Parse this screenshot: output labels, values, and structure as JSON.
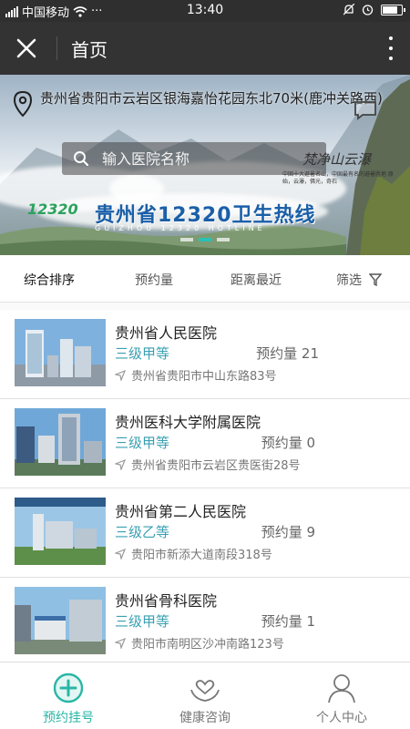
{
  "status_bar": {
    "carrier": "中国移动",
    "more": "···",
    "time": "13:40",
    "battery_level": 0.85
  },
  "header": {
    "title": "首页"
  },
  "banner": {
    "location": "贵州省贵阳市云岩区银海嘉怡花园东北70米(鹿冲关路西)",
    "search_placeholder": "输入医院名称",
    "calligraphy": "梵净山云瀑",
    "small_note": "中国十大避暑名山，中国最有名的避暑胜地 原始，云瀑，佛光，奇石",
    "hotline_logo": "12320",
    "hotline_title": "贵州省12320卫生热线",
    "hotline_sub": "GUIZHOU 12320 HOTLINE",
    "active_slide": 2
  },
  "filters": {
    "sort": "综合排序",
    "appointments": "预约量",
    "distance": "距离最近",
    "filter": "筛选"
  },
  "hospitals": [
    {
      "name": "贵州省人民医院",
      "grade": "三级甲等",
      "appointments": "预约量 21",
      "address": "贵州省贵阳市中山东路83号"
    },
    {
      "name": "贵州医科大学附属医院",
      "grade": "三级甲等",
      "appointments": "预约量 0",
      "address": "贵州省贵阳市云岩区贵医街28号"
    },
    {
      "name": "贵州省第二人民医院",
      "grade": "三级乙等",
      "appointments": "预约量 9",
      "address": "贵阳市新添大道南段318号"
    },
    {
      "name": "贵州省骨科医院",
      "grade": "三级甲等",
      "appointments": "预约量 1",
      "address": "贵阳市南明区沙冲南路123号"
    }
  ],
  "tabs": [
    {
      "label": "预约挂号",
      "icon": "plus-circle-icon",
      "active": true
    },
    {
      "label": "健康咨询",
      "icon": "heart-hands-icon",
      "active": false
    },
    {
      "label": "个人中心",
      "icon": "user-icon",
      "active": false
    }
  ],
  "colors": {
    "accent": "#2ab6a6",
    "grade": "#3aa0b2",
    "header_bg": "#333333"
  }
}
